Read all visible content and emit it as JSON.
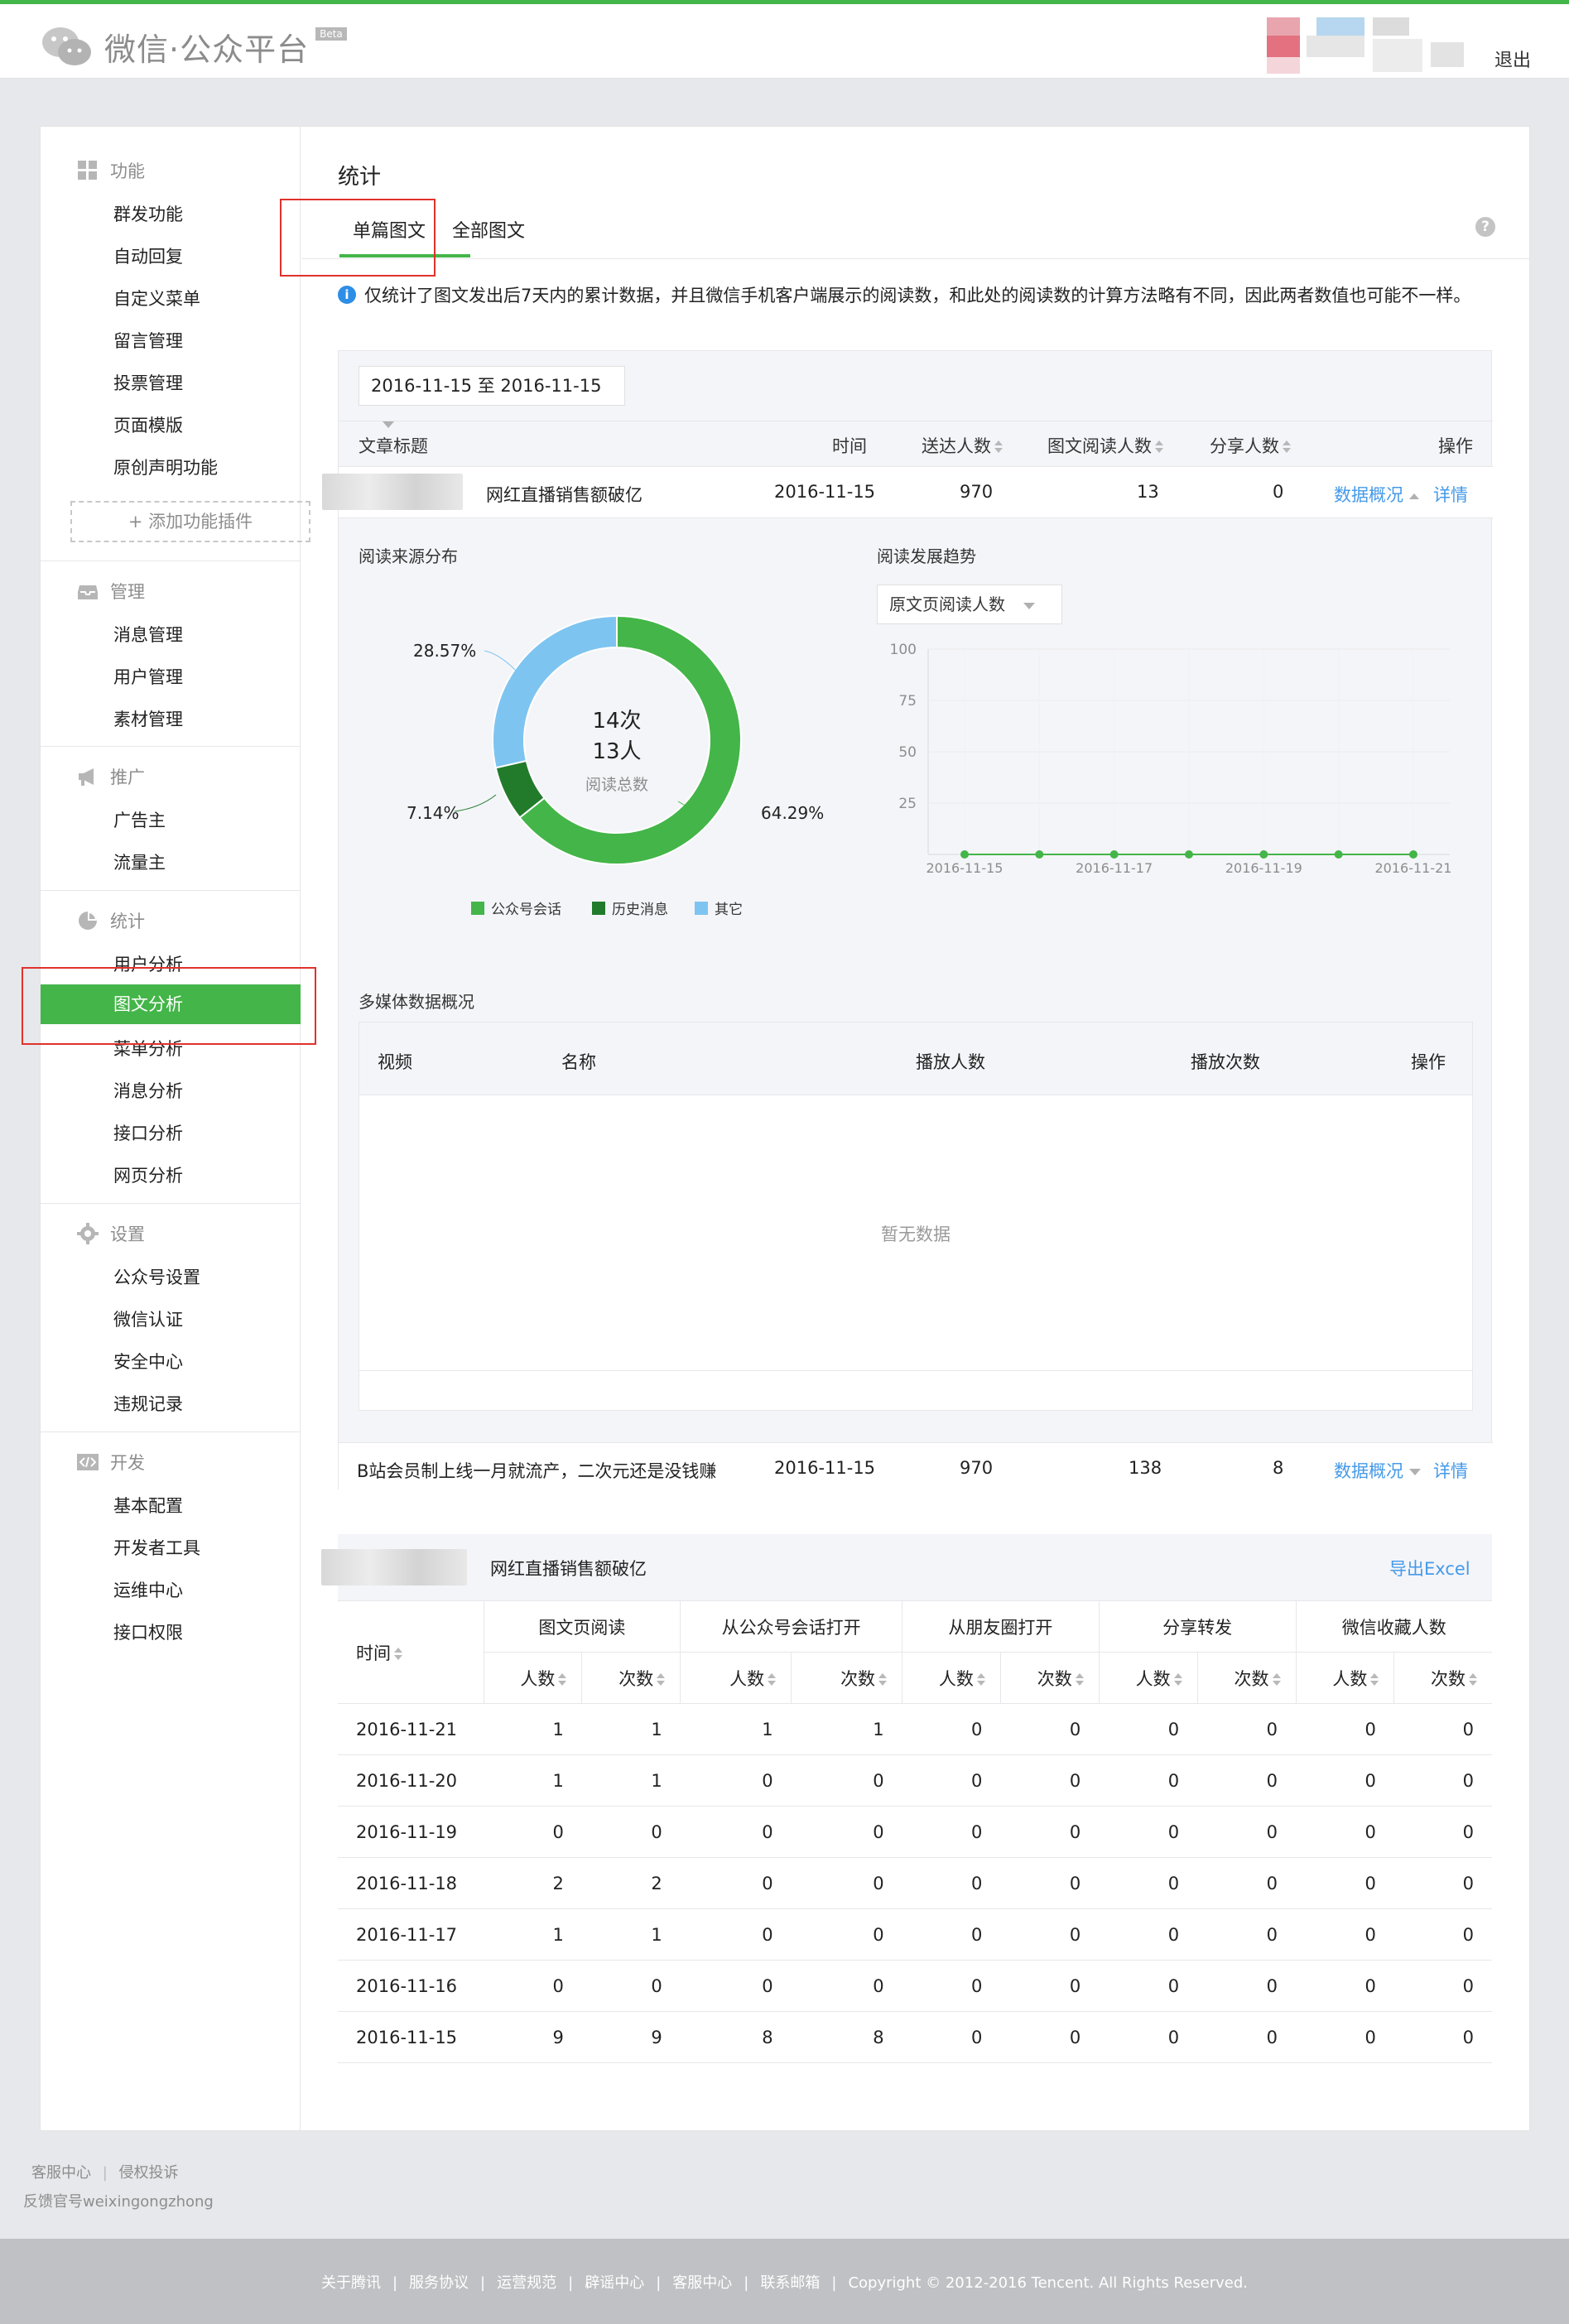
{
  "app": {
    "logo_text": "微信·公众平台",
    "beta": "Beta",
    "logout": "退出"
  },
  "sidebar": {
    "sections": [
      {
        "title": "功能",
        "icon": "grid-icon",
        "items": [
          "群发功能",
          "自动回复",
          "自定义菜单",
          "留言管理",
          "投票管理",
          "页面模版",
          "原创声明功能"
        ]
      },
      {
        "title": "管理",
        "icon": "inbox-icon",
        "items": [
          "消息管理",
          "用户管理",
          "素材管理"
        ]
      },
      {
        "title": "推广",
        "icon": "megaphone-icon",
        "items": [
          "广告主",
          "流量主"
        ]
      },
      {
        "title": "统计",
        "icon": "pie-icon",
        "items": [
          "用户分析",
          "图文分析",
          "菜单分析",
          "消息分析",
          "接口分析",
          "网页分析"
        ]
      },
      {
        "title": "设置",
        "icon": "gear-icon",
        "items": [
          "公众号设置",
          "微信认证",
          "安全中心",
          "违规记录"
        ]
      },
      {
        "title": "开发",
        "icon": "code-icon",
        "items": [
          "基本配置",
          "开发者工具",
          "运维中心",
          "接口权限"
        ]
      }
    ],
    "add_plugin": "+ 添加功能插件",
    "active_item": "图文分析"
  },
  "page": {
    "title": "统计",
    "tabs": [
      "单篇图文",
      "全部图文"
    ],
    "active_tab": "单篇图文",
    "notice": "仅统计了图文发出后7天内的累计数据，并且微信手机客户端展示的阅读数，和此处的阅读数的计算方法略有不同，因此两者数值也可能不一样。"
  },
  "article_list": {
    "date_range": "2016-11-15 至 2016-11-15",
    "columns": [
      "文章标题",
      "时间",
      "送达人数",
      "图文阅读人数",
      "分享人数",
      "操作"
    ],
    "rows": [
      {
        "title": "网红直播销售额破亿",
        "date": "2016-11-15",
        "delivered": "970",
        "readers": "13",
        "shares": "0",
        "action1": "数据概况",
        "action2": "详情"
      },
      {
        "title": "B站会员制上线一月就流产，二次元还是没钱赚",
        "date": "2016-11-15",
        "delivered": "970",
        "readers": "138",
        "shares": "8",
        "action1": "数据概况",
        "action2": "详情"
      }
    ]
  },
  "source": {
    "title": "阅读来源分布",
    "center_line1": "14次",
    "center_line2": "13人",
    "center_label": "阅读总数",
    "slices": [
      {
        "label": "公众号会话",
        "pct": 64.29,
        "text": "64.29%",
        "color": "#44b549"
      },
      {
        "label": "历史消息",
        "pct": 7.14,
        "text": "7.14%",
        "color": "#217b2b"
      },
      {
        "label": "其它",
        "pct": 28.57,
        "text": "28.57%",
        "color": "#7ec4f0"
      }
    ]
  },
  "trend": {
    "title": "阅读发展趋势",
    "select": "原文页阅读人数"
  },
  "chart_data": {
    "type": "line",
    "x": [
      "2016-11-15",
      "2016-11-16",
      "2016-11-17",
      "2016-11-18",
      "2016-11-19",
      "2016-11-20",
      "2016-11-21"
    ],
    "x_tick_labels": [
      "2016-11-15",
      "2016-11-17",
      "2016-11-19",
      "2016-11-21"
    ],
    "series": [
      {
        "values": [
          0,
          0,
          0,
          0,
          0,
          0,
          0
        ]
      }
    ],
    "ylim": [
      0,
      100
    ],
    "y_ticks": [
      25,
      50,
      75,
      100
    ],
    "grid": true
  },
  "media": {
    "title": "多媒体数据概况",
    "columns": [
      "视频",
      "名称",
      "播放人数",
      "播放次数",
      "操作"
    ],
    "empty": "暂无数据"
  },
  "detail": {
    "article": "网红直播销售额破亿",
    "export": "导出Excel",
    "date_col": "时间",
    "groups": [
      "图文页阅读",
      "从公众号会话打开",
      "从朋友圈打开",
      "分享转发",
      "微信收藏人数"
    ],
    "sub": [
      "人数",
      "次数"
    ],
    "rows": [
      [
        "2016-11-21",
        "1",
        "1",
        "1",
        "1",
        "0",
        "0",
        "0",
        "0",
        "0",
        "0"
      ],
      [
        "2016-11-20",
        "1",
        "1",
        "0",
        "0",
        "0",
        "0",
        "0",
        "0",
        "0",
        "0"
      ],
      [
        "2016-11-19",
        "0",
        "0",
        "0",
        "0",
        "0",
        "0",
        "0",
        "0",
        "0",
        "0"
      ],
      [
        "2016-11-18",
        "2",
        "2",
        "0",
        "0",
        "0",
        "0",
        "0",
        "0",
        "0",
        "0"
      ],
      [
        "2016-11-17",
        "1",
        "1",
        "0",
        "0",
        "0",
        "0",
        "0",
        "0",
        "0",
        "0"
      ],
      [
        "2016-11-16",
        "0",
        "0",
        "0",
        "0",
        "0",
        "0",
        "0",
        "0",
        "0",
        "0"
      ],
      [
        "2016-11-15",
        "9",
        "9",
        "8",
        "8",
        "0",
        "0",
        "0",
        "0",
        "0",
        "0"
      ]
    ]
  },
  "footer": {
    "links": [
      "客服中心",
      "侵权投诉"
    ],
    "feedback": "反馈官号weixingongzhong",
    "bottom_links": [
      "关于腾讯",
      "服务协议",
      "运营规范",
      "辟谣中心",
      "客服中心",
      "联系邮箱"
    ],
    "copyright": "Copyright © 2012-2016 Tencent. All Rights Reserved."
  },
  "colors": {
    "accent": "#44b549",
    "link": "#459ae9",
    "highlight_box": "#e0322b"
  }
}
